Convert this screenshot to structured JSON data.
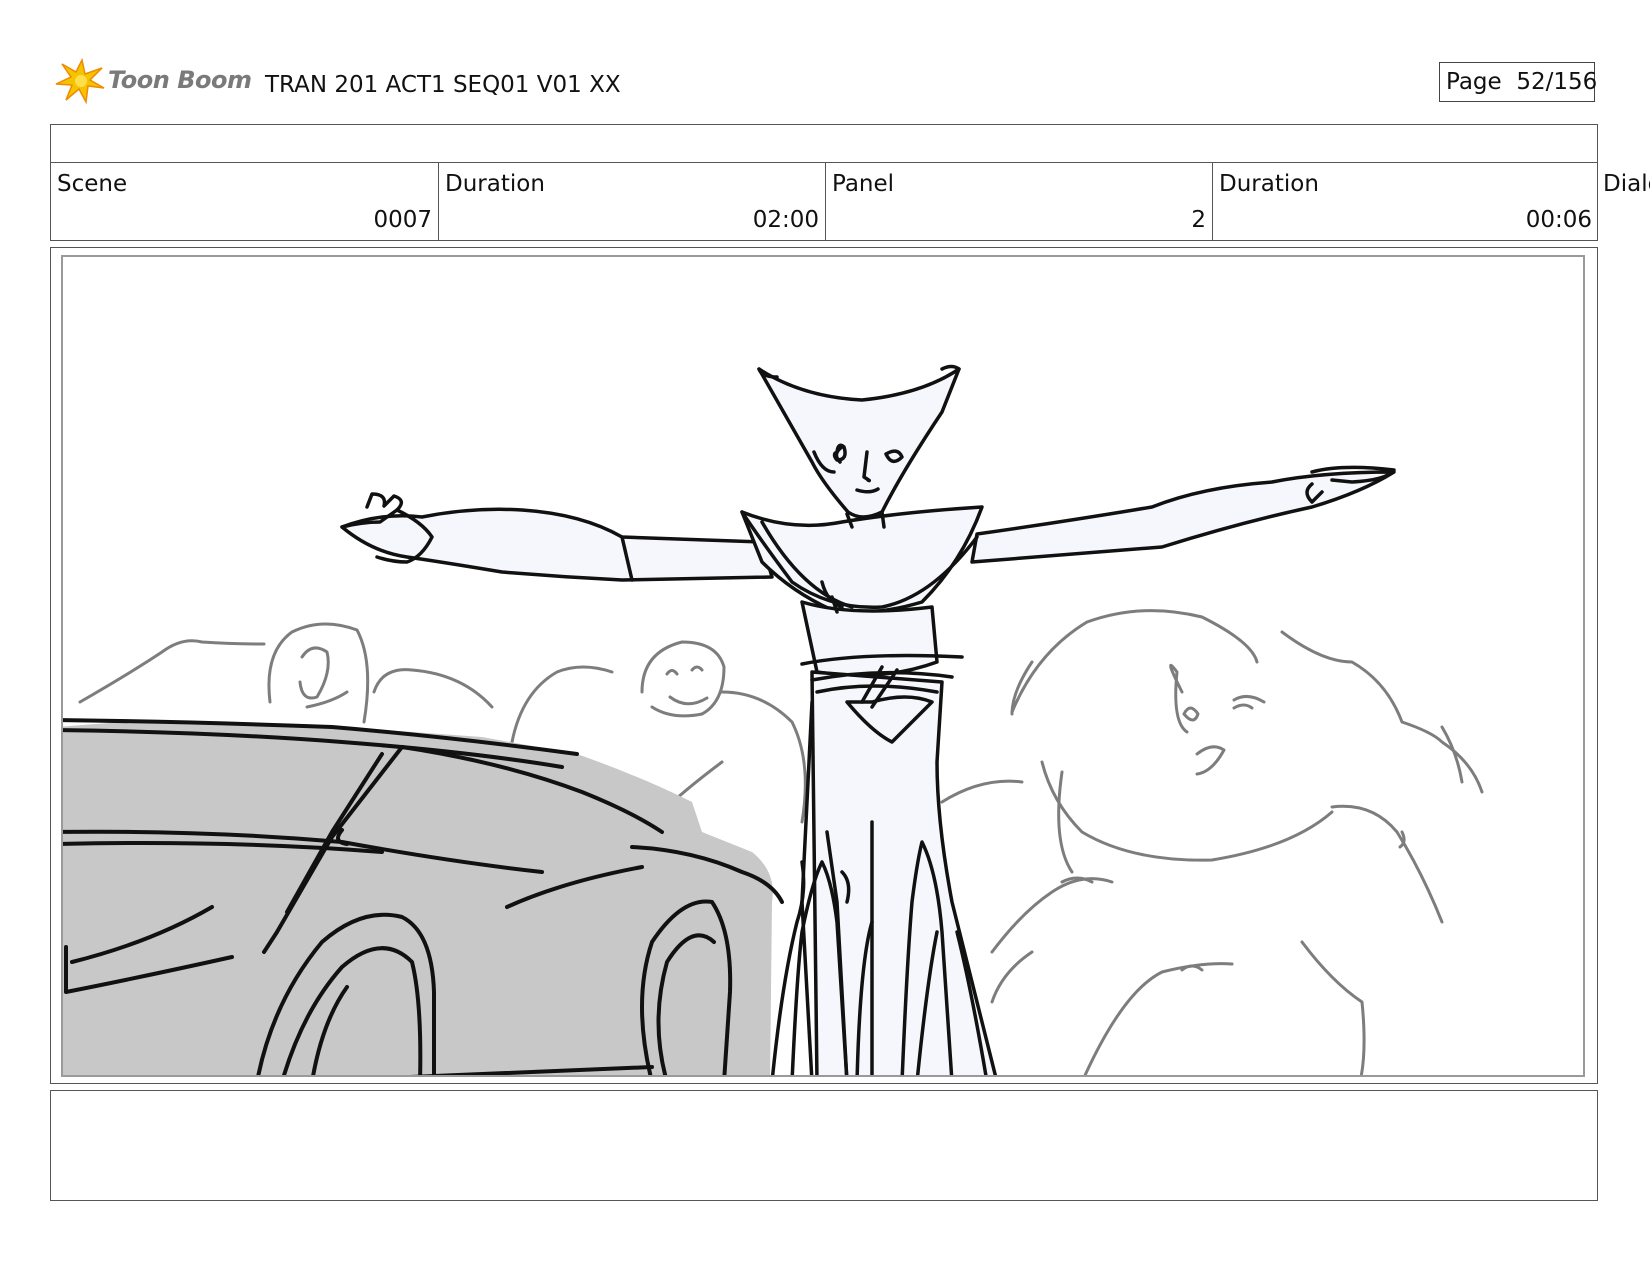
{
  "header": {
    "logo_text": "Toon Boom",
    "title": "TRAN 201 ACT1 SEQ01 V01 XX",
    "page_label": "Page",
    "page_value": "52/156"
  },
  "info": {
    "scene": {
      "label": "Scene",
      "value": "0007"
    },
    "scene_duration": {
      "label": "Duration",
      "value": "02:00"
    },
    "panel": {
      "label": "Panel",
      "value": "2"
    },
    "panel_duration": {
      "label": "Duration",
      "value": "00:06"
    },
    "dialog_label": "Dialo"
  },
  "colors": {
    "logo_yellow": "#f5c400",
    "logo_orange": "#f08a00",
    "car_fill": "#c8c8c8",
    "figure_fill": "#f5f7fc"
  },
  "icons": {
    "logo": "toon-boom-star-icon"
  }
}
